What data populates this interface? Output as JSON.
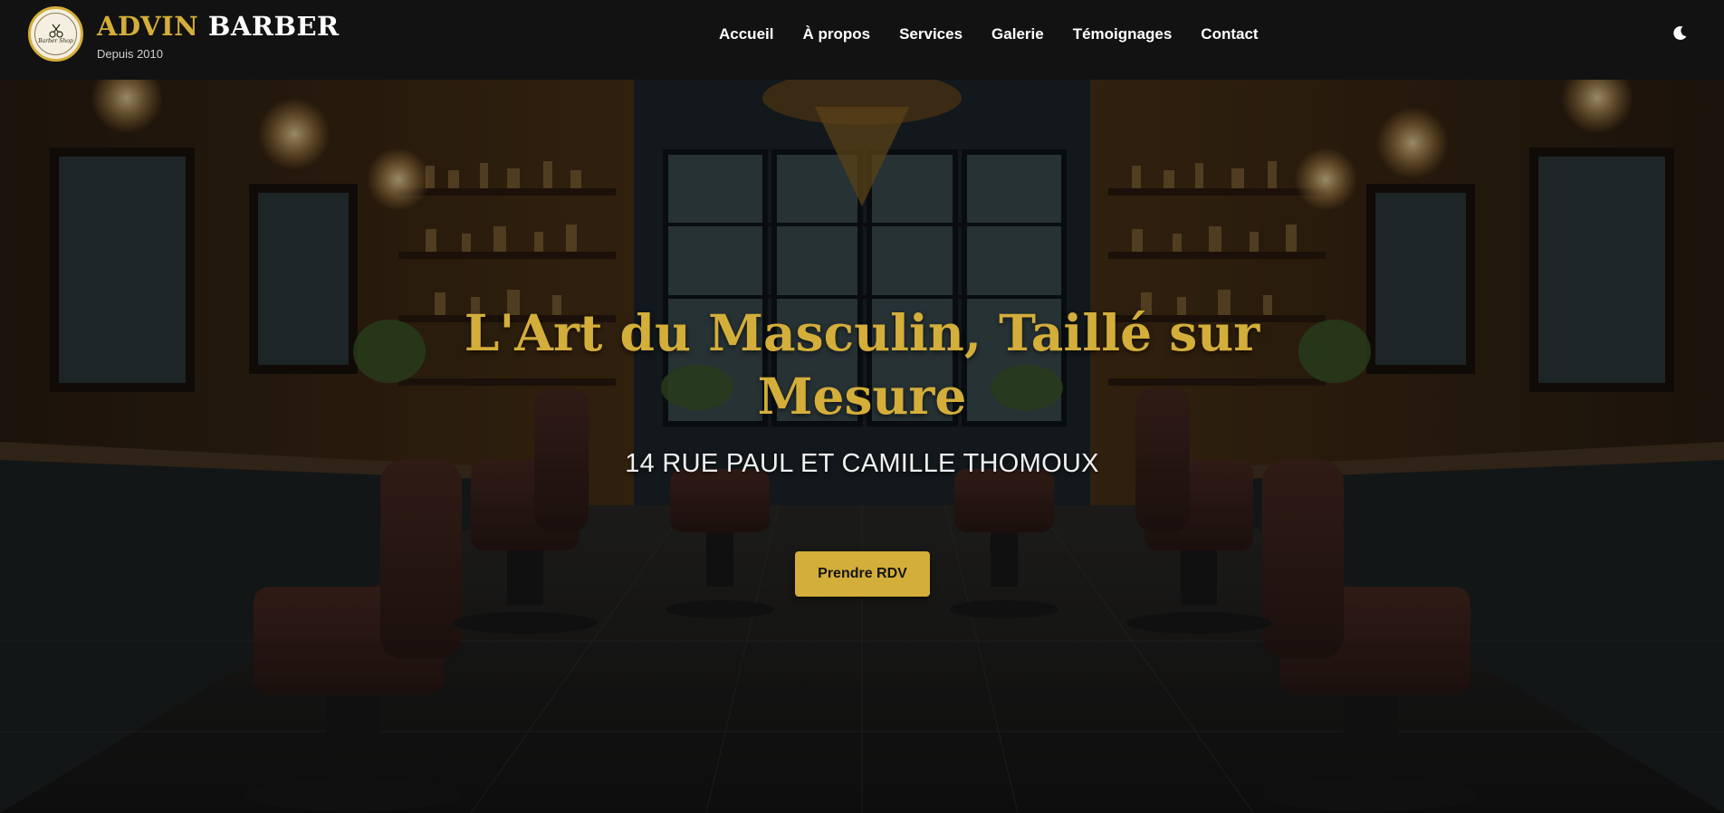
{
  "header": {
    "brand_part1": "ADVIN",
    "brand_part2": "BARBER",
    "since": "Depuis 2010",
    "logo_script": "Barber Shop",
    "theme_toggle_icon": "moon-icon"
  },
  "nav": {
    "items": [
      {
        "label": "Accueil"
      },
      {
        "label": "À propos"
      },
      {
        "label": "Services"
      },
      {
        "label": "Galerie"
      },
      {
        "label": "Témoignages"
      },
      {
        "label": "Contact"
      }
    ]
  },
  "hero": {
    "title_line1": "L'Art du Masculin, Taillé sur",
    "title_line2": "Mesure",
    "address": "14 RUE PAUL ET CAMILLE THOMOUX",
    "cta_label": "Prendre RDV",
    "background_image": "barbershop-interior-photo"
  },
  "colors": {
    "accent_gold": "#d4ae3a",
    "header_bg": "#121212",
    "text_light": "#ffffff"
  }
}
